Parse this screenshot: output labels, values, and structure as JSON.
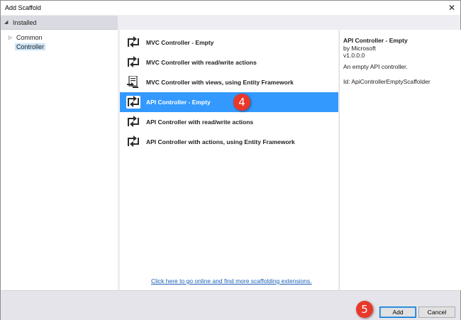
{
  "window": {
    "title": "Add Scaffold",
    "close_glyph": "✕"
  },
  "sidebar": {
    "header": "Installed",
    "items": [
      {
        "label": "Common",
        "expander": "▷"
      },
      {
        "label": "Controller"
      }
    ]
  },
  "scaffolds": [
    {
      "label": "MVC Controller - Empty",
      "icon": "controller-arrows-icon"
    },
    {
      "label": "MVC Controller with read/write actions",
      "icon": "controller-arrows-icon"
    },
    {
      "label": "MVC Controller with views, using Entity Framework",
      "icon": "controller-views-icon"
    },
    {
      "label": "API Controller - Empty",
      "icon": "controller-arrows-icon",
      "selected": true
    },
    {
      "label": "API Controller with read/write actions",
      "icon": "controller-arrows-icon"
    },
    {
      "label": "API Controller with actions, using Entity Framework",
      "icon": "controller-arrows-icon"
    }
  ],
  "online_link": "Click here to go online and find more scaffolding extensions.",
  "details": {
    "title": "API Controller - Empty",
    "author": "by Microsoft",
    "version": "v1.0.0.0",
    "description": "An empty API controller.",
    "id": "Id: ApiControllerEmptyScaffolder"
  },
  "buttons": {
    "add": "Add",
    "cancel": "Cancel"
  },
  "callouts": {
    "step4": "4",
    "step5": "5"
  },
  "colors": {
    "selection": "#3399ff",
    "badge": "#e8382a",
    "link": "#1a5fb4"
  }
}
